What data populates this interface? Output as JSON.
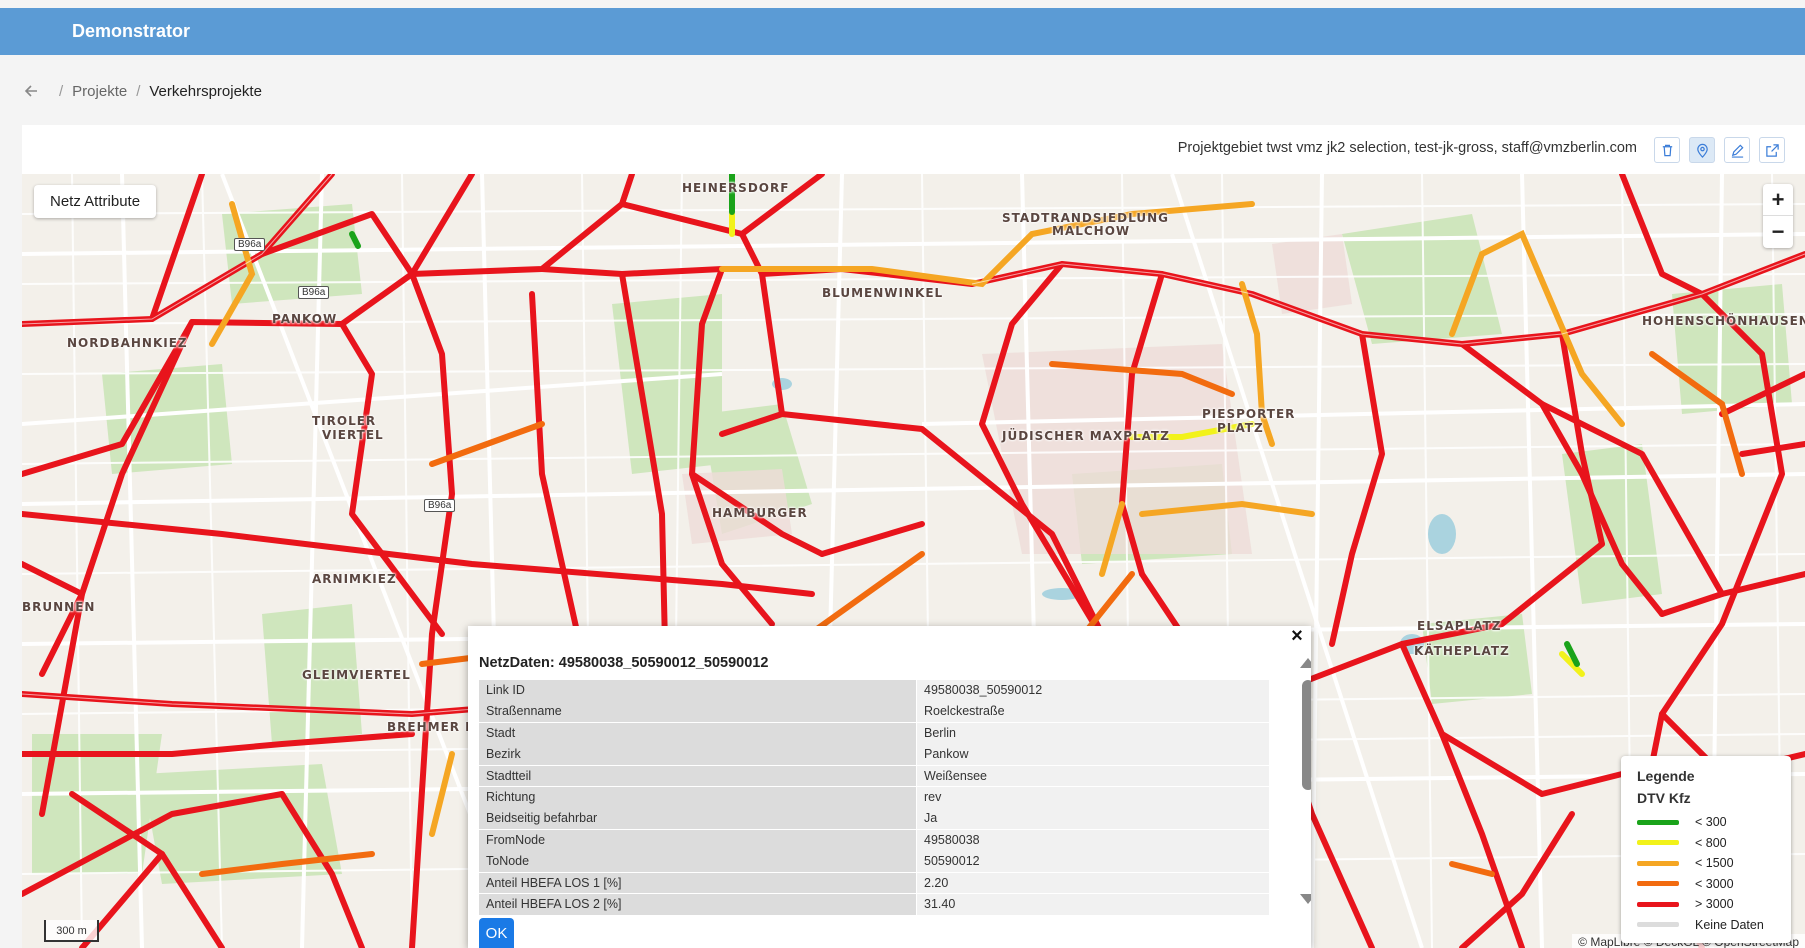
{
  "app": {
    "title": "Demonstrator"
  },
  "breadcrumb": {
    "items": [
      "Projekte",
      "Verkehrsprojekte"
    ]
  },
  "toolbar": {
    "project_info": "Projektgebiet twst vmz jk2 selection, test-jk-gross, staff@vmzberlin.com",
    "icons": [
      "trash-icon",
      "map-pin-icon",
      "edit-icon",
      "external-link-icon"
    ]
  },
  "map": {
    "netz_button": "Netz Attribute",
    "zoom_in": "+",
    "zoom_out": "−",
    "scale": "300 m",
    "attribution": "© MapLibre © DeckGL © OpenStreetMap",
    "labels": {
      "heinersdorf": "HEINERSDORF",
      "stadtrand": "STADTRANDSIEDLUNG",
      "malchow": "MALCHOW",
      "blumenwinkel": "BLUMENWINKEL",
      "pankow": "PANKOW",
      "nordbahn": "NORDBAHNKIEZ",
      "hohenschoen": "HOHENSCHÖNHAUSEN",
      "tiroler": "TIROLER",
      "viertel": "VIERTEL",
      "piesporter": "PIESPORTER",
      "platz": "PLATZ",
      "jaffe": "JÜDISCHER MAXPLATZ",
      "hamburger": "HAMBURGER",
      "arnimkiez": "ARNIMKIEZ",
      "brunnen": "BRUNNEN",
      "gleimviertel": "GLEIMVIERTEL",
      "brehm": "BREHMER HOF",
      "elsaplatz": "ELSAPLATZ",
      "katheplatz": "KÄTHEPLATZ",
      "b96a": "B96a"
    }
  },
  "legend": {
    "title": "Legende",
    "subtitle": "DTV Kfz",
    "items": [
      {
        "label": "< 300",
        "color": "#1aa31a"
      },
      {
        "label": "< 800",
        "color": "#f2f21a"
      },
      {
        "label": "< 1500",
        "color": "#f5a623"
      },
      {
        "label": "< 3000",
        "color": "#f26b0f"
      },
      {
        "label": "> 3000",
        "color": "#e8141c"
      },
      {
        "label": "Keine Daten",
        "color": "#dcdcdc"
      }
    ]
  },
  "popup": {
    "title": "NetzDaten: 49580038_50590012_50590012",
    "rows": [
      {
        "key": "Link ID",
        "value": "49580038_50590012"
      },
      {
        "key": "Straßenname",
        "value": "Roelckestraße"
      },
      {
        "key": "Stadt",
        "value": "Berlin"
      },
      {
        "key": "Bezirk",
        "value": "Pankow"
      },
      {
        "key": "Stadtteil",
        "value": "Weißensee"
      },
      {
        "key": "Richtung",
        "value": "rev"
      },
      {
        "key": "Beidseitig befahrbar",
        "value": "Ja"
      },
      {
        "key": "FromNode",
        "value": "49580038"
      },
      {
        "key": "ToNode",
        "value": "50590012"
      },
      {
        "key": "Anteil HBEFA LOS 1 [%]",
        "value": "2.20"
      },
      {
        "key": "Anteil HBEFA LOS 2 [%]",
        "value": "31.40"
      }
    ],
    "ok_label": "OK",
    "close_label": "×"
  }
}
